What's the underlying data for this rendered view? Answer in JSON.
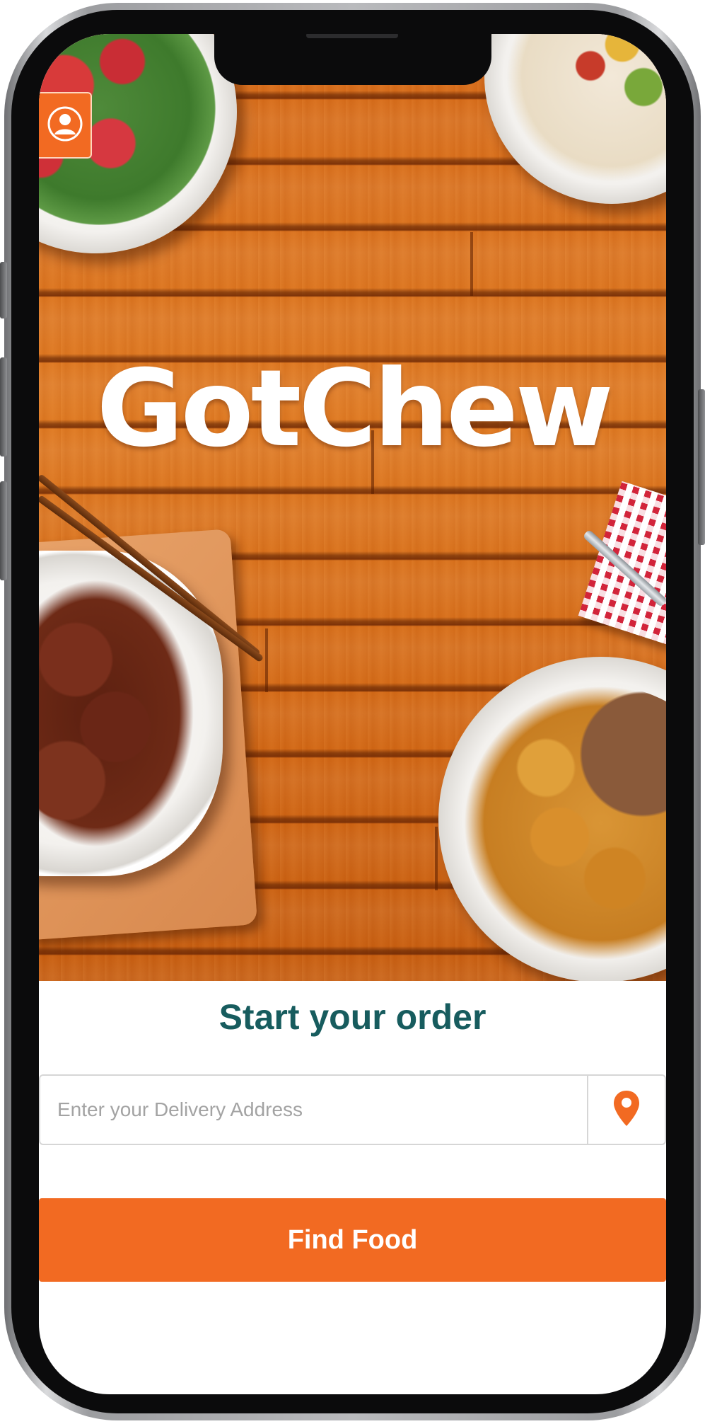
{
  "app": {
    "logo_text": "GotChew"
  },
  "header": {
    "profile_icon": "user-icon"
  },
  "order": {
    "title": "Start your order",
    "address_placeholder": "Enter your Delivery Address",
    "address_value": "",
    "locate_icon": "map-pin-icon",
    "find_button_label": "Find Food"
  },
  "colors": {
    "accent": "#f26a22",
    "title": "#175c5e",
    "placeholder": "#a3a3a3"
  }
}
